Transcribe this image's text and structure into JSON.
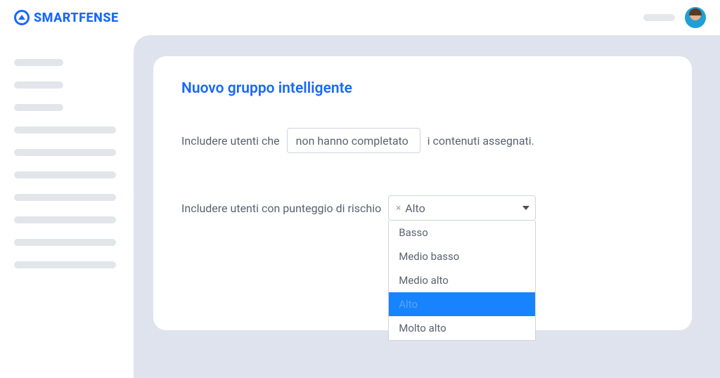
{
  "brand": {
    "name": "SMARTFENSE"
  },
  "card": {
    "title": "Nuovo gruppo intelligente",
    "row1": {
      "prefix": "Includere utenti che",
      "select_value": "non hanno completato",
      "suffix": "i contenuti assegnati."
    },
    "row2": {
      "prefix": "Includere utenti con punteggio di rischio",
      "selected_value": "Alto",
      "options": [
        "Basso",
        "Medio basso",
        "Medio alto",
        "Alto",
        "Molto alto"
      ],
      "selected_index": 3
    }
  }
}
